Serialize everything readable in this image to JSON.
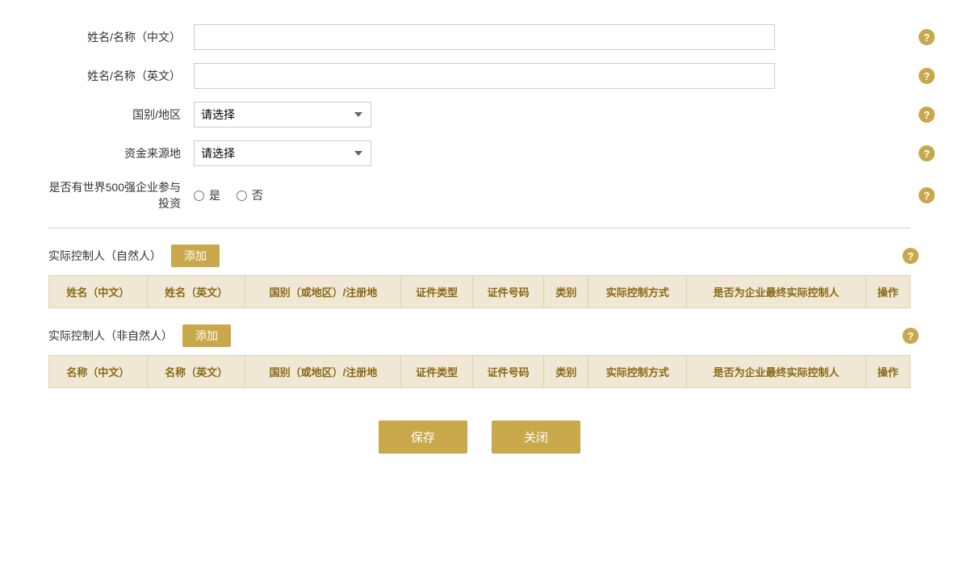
{
  "form": {
    "name_cn_label": "姓名/名称（中文）",
    "name_cn_value": "",
    "name_en_label": "姓名/名称（英文）",
    "name_en_value": "",
    "country_label": "国别/地区",
    "country_placeholder": "请选择",
    "fund_source_label": "资金来源地",
    "fund_source_placeholder": "请选择",
    "fortune500_label": "是否有世界500强企业参与投资",
    "fortune500_yes": "是",
    "fortune500_no": "否"
  },
  "natural_person_section": {
    "title": "实际控制人（自然人）",
    "add_btn": "添加",
    "columns": [
      "姓名（中文）",
      "姓名（英文）",
      "国别（或地区）/注册地",
      "证件类型",
      "证件号码",
      "类别",
      "实际控制方式",
      "是否为企业最终实际控制人",
      "操作"
    ]
  },
  "non_natural_person_section": {
    "title": "实际控制人（非自然人）",
    "add_btn": "添加",
    "columns": [
      "名称（中文）",
      "名称（英文）",
      "国别（或地区）/注册地",
      "证件类型",
      "证件号码",
      "类别",
      "实际控制方式",
      "是否为企业最终实际控制人",
      "操作"
    ]
  },
  "buttons": {
    "save": "保存",
    "close": "关闭"
  },
  "help_icon_text": "?"
}
